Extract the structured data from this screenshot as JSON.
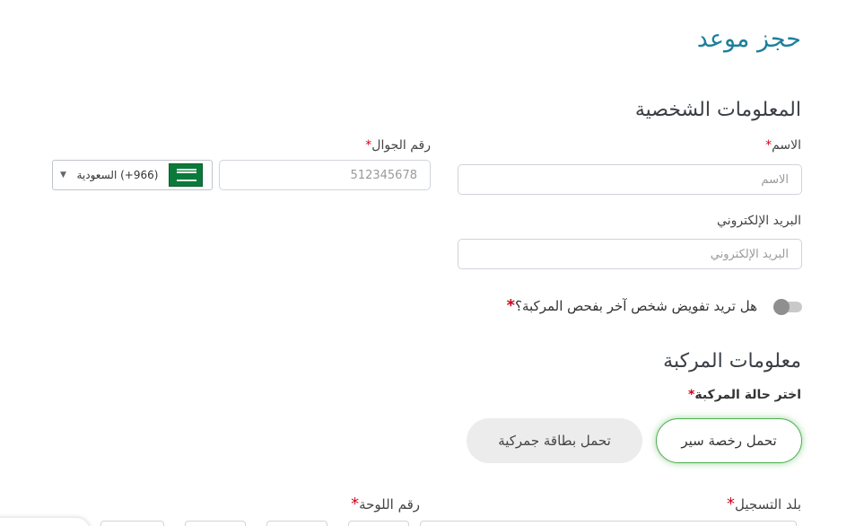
{
  "page": {
    "title": "حجز موعد"
  },
  "personal": {
    "section_title": "المعلومات الشخصية",
    "name": {
      "label": "الاسم",
      "required_mark": "*",
      "placeholder": "الاسم"
    },
    "mobile": {
      "label": "رقم الجوال",
      "required_mark": "*",
      "placeholder": "512345678"
    },
    "country_code": {
      "value": "(966+) السعودية",
      "flag_icon": "saudi-flag-icon",
      "dropdown_icon": "caret-down-icon"
    },
    "email": {
      "label": "البريد الإلكتروني",
      "placeholder": "البريد الإلكتروني"
    },
    "delegate": {
      "question": "هل تريد تفويض شخص آخر بفحص المركبة؟",
      "required_mark": "*"
    }
  },
  "vehicle": {
    "section_title": "معلومات المركبة",
    "status_label": "اختر حالة المركبة",
    "required_mark": "*",
    "options": {
      "license": "تحمل رخصة سير",
      "customs": "تحمل بطاقة جمركية"
    },
    "registration_country": {
      "label": "بلد التسجيل",
      "required_mark": "*"
    },
    "plate_number": {
      "label": "رقم اللوحة",
      "required_mark": "*"
    }
  },
  "colors": {
    "title": "#1d7f9c",
    "active_border": "#4caf50",
    "required": "#d0021b"
  }
}
